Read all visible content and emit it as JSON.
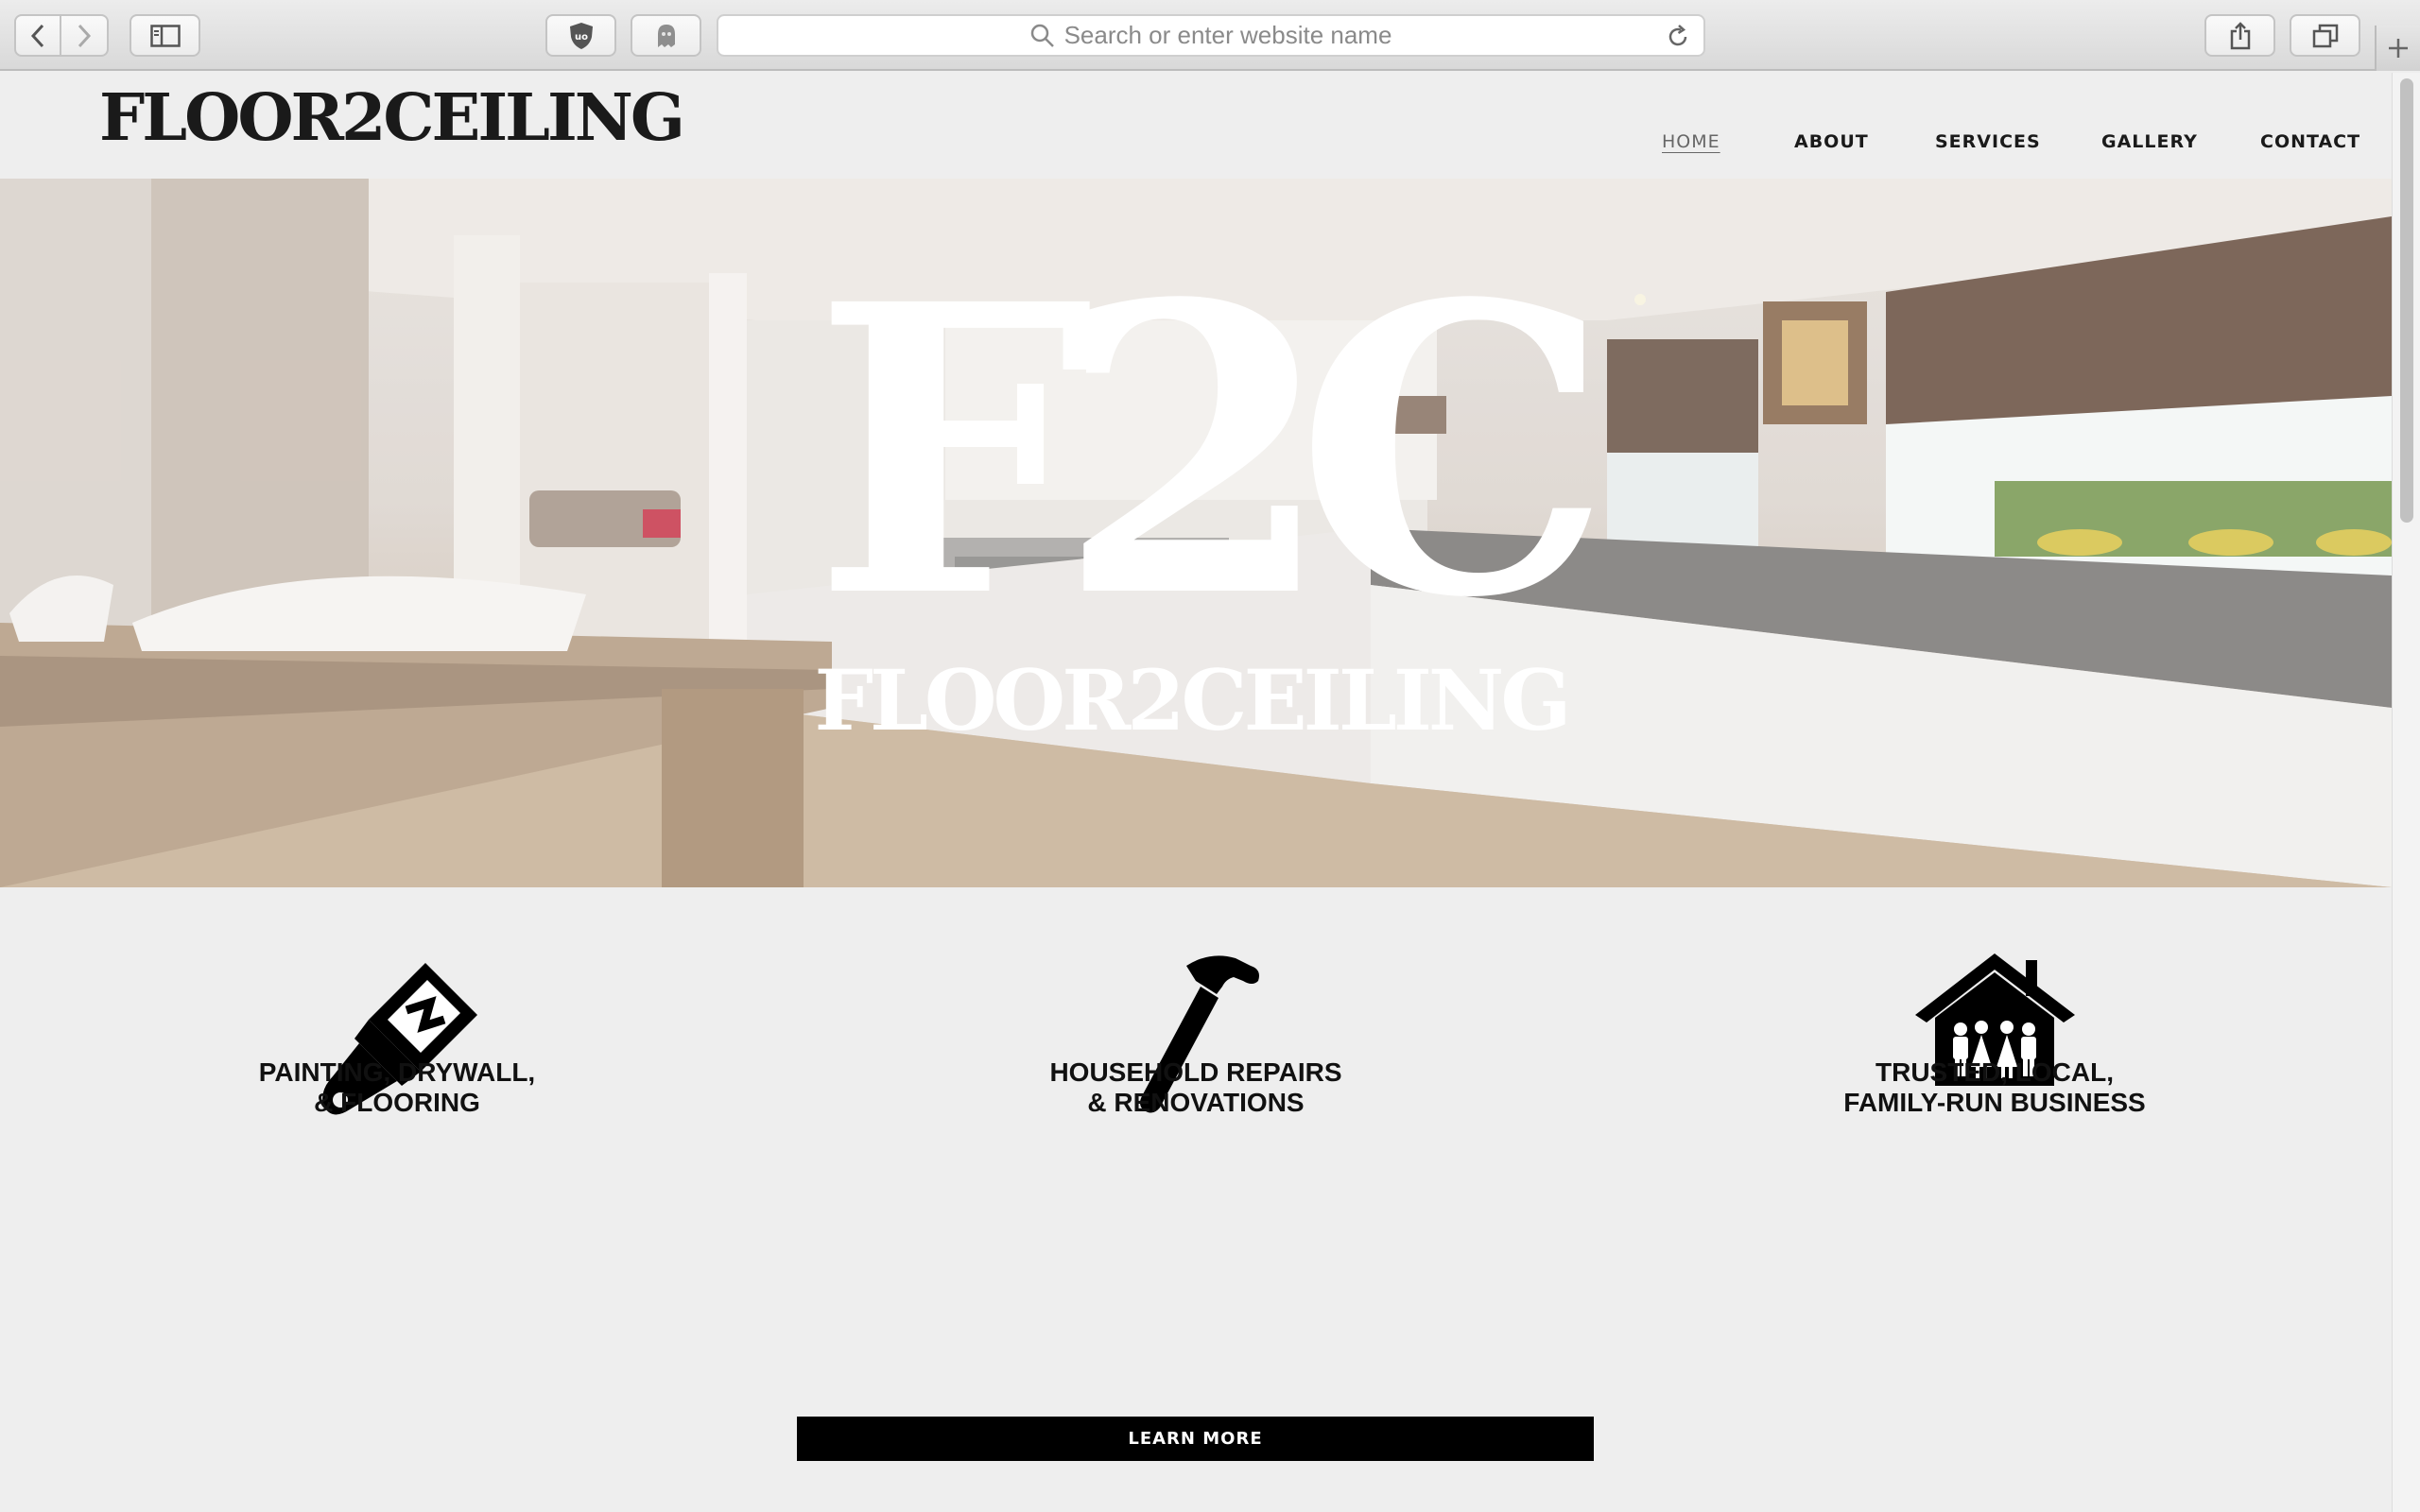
{
  "browser": {
    "url_placeholder": "Search or enter website name"
  },
  "header": {
    "logo": "FLOOR2CEILING",
    "nav": [
      "HOME",
      "ABOUT",
      "SERVICES",
      "GALLERY",
      "CONTACT"
    ],
    "active_nav": "HOME"
  },
  "hero": {
    "monogram": "F2C",
    "wordmark": "FLOOR2CEILING"
  },
  "features": [
    {
      "icon": "paintbrush-icon",
      "line1": "PAINTING, DRYWALL,",
      "line2": "& FLOORING"
    },
    {
      "icon": "hammer-icon",
      "line1": "HOUSEHOLD REPAIRS",
      "line2": "& RENOVATIONS"
    },
    {
      "icon": "family-house-icon",
      "line1": "TRUSTED, LOCAL,",
      "line2": "FAMILY-RUN BUSINESS"
    }
  ],
  "cta": {
    "label": "LEARN MORE"
  },
  "colors": {
    "background": "#eeeeee",
    "text": "#111111",
    "button": "#000000",
    "button_text": "#ffffff"
  }
}
